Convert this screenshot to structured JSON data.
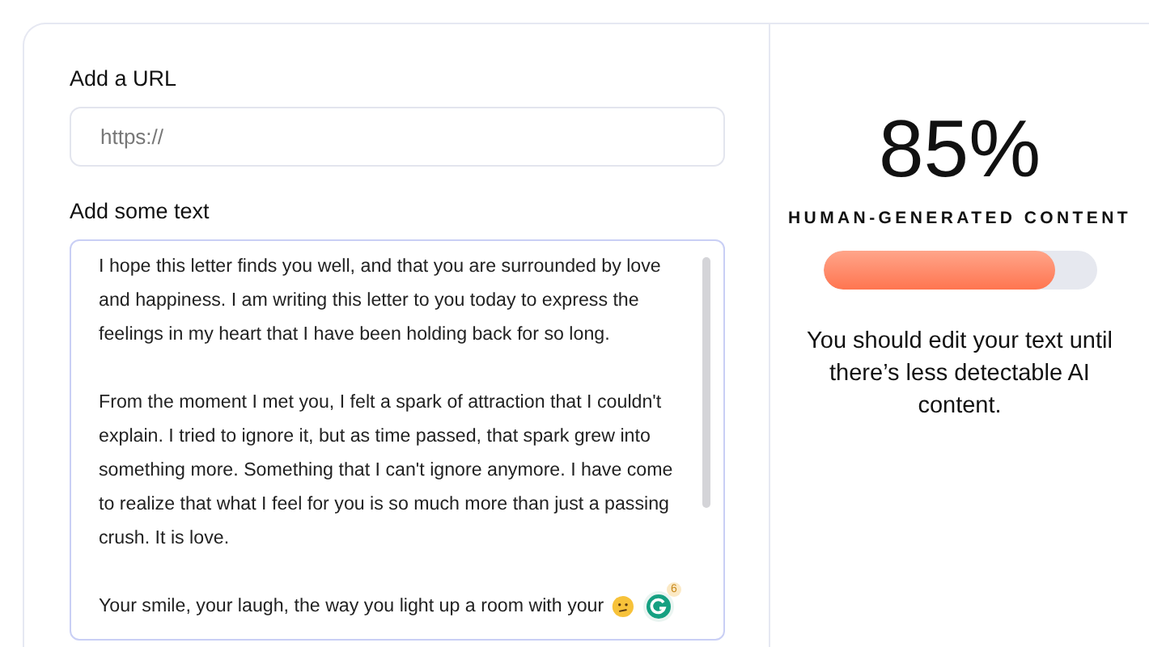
{
  "url_field": {
    "label": "Add a URL",
    "placeholder": "https://"
  },
  "text_field": {
    "label": "Add some text",
    "paragraphs": [
      [
        "I hope this letter finds you well, and that you are surrounded by love",
        "and happiness. I am writing this letter to you today to express the",
        "feelings in my heart that I have been holding back for so long."
      ],
      [
        "From the moment I met you, I felt a spark of attraction that I couldn't",
        "explain. I tried to ignore it, but as time passed, that spark grew into",
        "something more. Something that I can't ignore anymore. I have come",
        "to realize that what I feel for you is so much more than just a passing",
        "crush. It is love."
      ],
      [
        "Your smile, your laugh, the way you light up a room with your"
      ]
    ],
    "assistant_badge": "6"
  },
  "result": {
    "score": "85%",
    "caption": "HUMAN-GENERATED CONTENT",
    "level": 0.85,
    "message": "You should edit your text until there’s less detectable AI content."
  }
}
